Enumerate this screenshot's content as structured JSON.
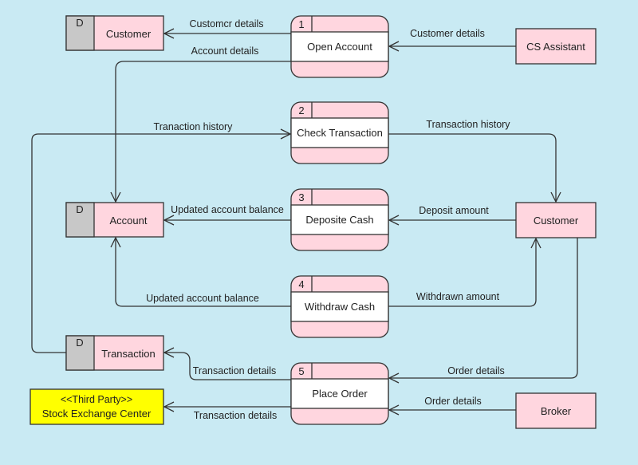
{
  "colors": {
    "background": "#c9eaf3",
    "entity_fill": "#ffd6df",
    "store_id_fill": "#c8c8c8",
    "process_body": "#ffffff",
    "third_party_fill": "#ffff00"
  },
  "data_stores": [
    {
      "id": "D",
      "name": "Customer"
    },
    {
      "id": "D",
      "name": "Account"
    },
    {
      "id": "D",
      "name": "Transaction"
    }
  ],
  "processes": [
    {
      "number": "1",
      "name": "Open Account"
    },
    {
      "number": "2",
      "name": "Check Transaction"
    },
    {
      "number": "3",
      "name": "Deposite Cash"
    },
    {
      "number": "4",
      "name": "Withdraw Cash"
    },
    {
      "number": "5",
      "name": "Place Order"
    }
  ],
  "external_entities": [
    {
      "name": "CS Assistant"
    },
    {
      "name": "Customer"
    },
    {
      "name": "Broker"
    },
    {
      "stereotype": "<<Third Party>>",
      "name": "Stock Exchange Center"
    }
  ],
  "flows": [
    {
      "from": "Open Account",
      "to": "Customer (store)",
      "label": "Customcr details"
    },
    {
      "from": "CS Assistant",
      "to": "Open Account",
      "label": "Customer details"
    },
    {
      "from": "Open Account",
      "to": "Account",
      "label": "Account details"
    },
    {
      "from": "Transaction",
      "to": "Check Transaction",
      "label": "Tranaction history"
    },
    {
      "from": "Check Transaction",
      "to": "Customer",
      "label": "Transaction history"
    },
    {
      "from": "Deposite Cash",
      "to": "Account",
      "label": "Updated account balance"
    },
    {
      "from": "Customer",
      "to": "Deposite Cash",
      "label": "Deposit amount"
    },
    {
      "from": "Withdraw Cash",
      "to": "Account",
      "label": "Updated account balance"
    },
    {
      "from": "Withdraw Cash",
      "to": "Customer",
      "label": "Withdrawn amount"
    },
    {
      "from": "Place Order",
      "to": "Transaction",
      "label": "Transaction details"
    },
    {
      "from": "Customer",
      "to": "Place Order",
      "label": "Order details"
    },
    {
      "from": "Place Order",
      "to": "Stock Exchange Center",
      "label": "Transaction details"
    },
    {
      "from": "Broker",
      "to": "Place Order",
      "label": "Order details"
    }
  ]
}
